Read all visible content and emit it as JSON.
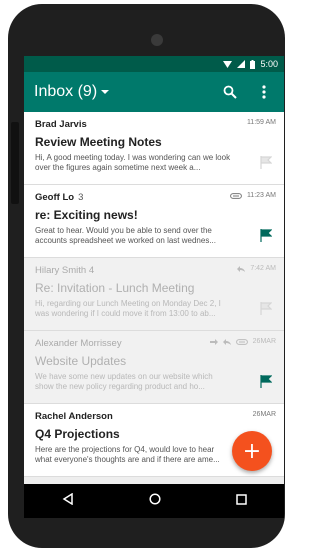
{
  "status_bar": {
    "time": "5:00"
  },
  "app_bar": {
    "title": "Inbox (9)",
    "search_icon": "search-icon",
    "menu_icon": "overflow-menu-icon"
  },
  "emails": [
    {
      "sender": "Brad Jarvis",
      "count": "",
      "subject": "Review Meeting Notes",
      "snippet": "Hi, A good meeting today. I was wondering can we look over the figures again sometime next week a...",
      "time": "11:59 AM",
      "flagged": false,
      "read": false
    },
    {
      "sender": "Geoff Lo",
      "count": "3",
      "subject": "re: Exciting news!",
      "snippet": "Great to hear. Would you be able to send over the accounts spreadsheet we worked on last wednes...",
      "time": "11:23 AM",
      "flagged": true,
      "read": false,
      "icons": [
        "attachment-icon"
      ]
    },
    {
      "sender": "Hilary Smith",
      "count": "4",
      "subject": "Re: Invitation - Lunch Meeting",
      "snippet": "Hi, regarding our Lunch Meeting on Monday Dec 2, I was wondering if I could move it from 13:00 to ab...",
      "time": "7:42 AM",
      "flagged": false,
      "read": true,
      "icons": [
        "reply-icon"
      ]
    },
    {
      "sender": "Alexander Morrissey",
      "count": "",
      "subject": "Website Updates",
      "snippet": "We have some new updates on our website which show the new policy regarding product and ho...",
      "time": "26MAR",
      "flagged": true,
      "read": true,
      "icons": [
        "forward-icon",
        "reply-icon",
        "attachment-icon"
      ]
    },
    {
      "sender": "Rachel Anderson",
      "count": "",
      "subject": "Q4 Projections",
      "snippet": "Here are the projections for Q4, would love to hear what everyone's thoughts are and if there are ame...",
      "time": "26MAR",
      "flagged": false,
      "read": false
    }
  ],
  "fab": {
    "label": "+"
  },
  "colors": {
    "primary": "#00796b",
    "primary_dark": "#005b4a",
    "accent": "#f4511e",
    "flag_active": "#00695c"
  }
}
